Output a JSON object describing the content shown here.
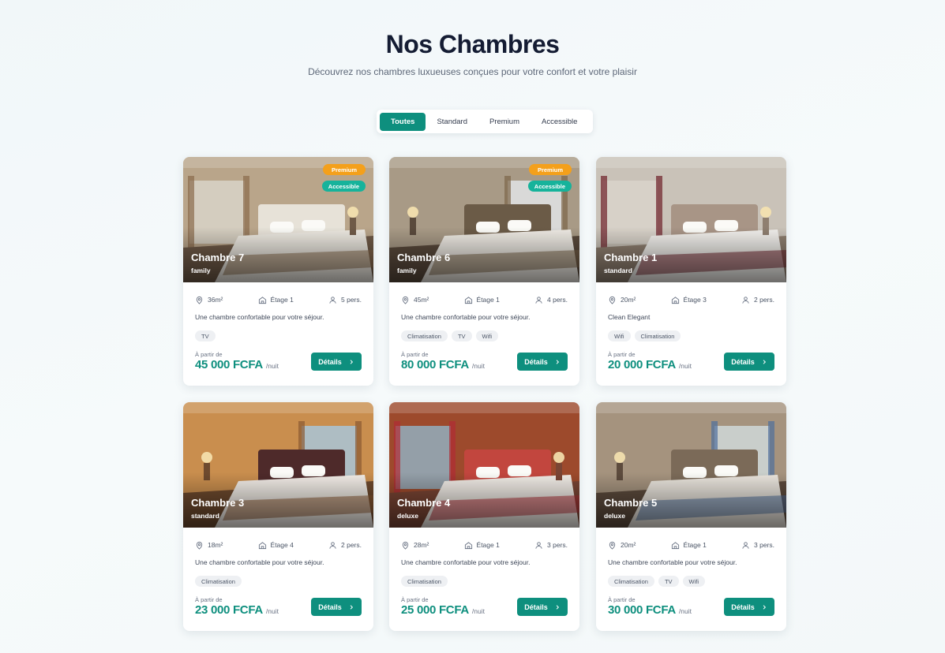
{
  "page": {
    "title": "Nos Chambres",
    "subtitle": "Découvrez nos chambres luxueuses conçues pour votre confort et votre plaisir"
  },
  "filters": [
    {
      "label": "Toutes",
      "active": true
    },
    {
      "label": "Standard",
      "active": false
    },
    {
      "label": "Premium",
      "active": false
    },
    {
      "label": "Accessible",
      "active": false
    }
  ],
  "colors": {
    "accent": "#0e8f7e",
    "premium_badge": "#f4a01b",
    "accessible_badge": "#16b39b"
  },
  "icons": {
    "area": "map-pin-icon",
    "floor": "home-icon",
    "capacity": "user-icon",
    "details": "chevron-right-icon"
  },
  "labels": {
    "price_prefix": "À partir de",
    "price_unit": "/nuit",
    "details_button": "Détails"
  },
  "rooms": [
    {
      "name": "Chambre 7",
      "type": "family",
      "badges": [
        "Premium",
        "Accessible"
      ],
      "area": "36m²",
      "floor": "Étage 1",
      "capacity": "5 pers.",
      "description": "Une chambre confortable pour votre séjour.",
      "amenities": [
        "TV"
      ],
      "price": "45 000 FCFA"
    },
    {
      "name": "Chambre 6",
      "type": "family",
      "badges": [
        "Premium",
        "Accessible"
      ],
      "area": "45m²",
      "floor": "Étage 1",
      "capacity": "4 pers.",
      "description": "Une chambre confortable pour votre séjour.",
      "amenities": [
        "Climatisation",
        "TV",
        "Wifi"
      ],
      "price": "80 000 FCFA"
    },
    {
      "name": "Chambre 1",
      "type": "standard",
      "badges": [],
      "area": "20m²",
      "floor": "Étage 3",
      "capacity": "2 pers.",
      "description": "Clean Elegant",
      "amenities": [
        "Wifi",
        "Climatisation"
      ],
      "price": "20 000 FCFA"
    },
    {
      "name": "Chambre 3",
      "type": "standard",
      "badges": [],
      "area": "18m²",
      "floor": "Étage 4",
      "capacity": "2 pers.",
      "description": "Une chambre confortable pour votre séjour.",
      "amenities": [
        "Climatisation"
      ],
      "price": "23 000 FCFA"
    },
    {
      "name": "Chambre 4",
      "type": "deluxe",
      "badges": [],
      "area": "28m²",
      "floor": "Étage 1",
      "capacity": "3 pers.",
      "description": "Une chambre confortable pour votre séjour.",
      "amenities": [
        "Climatisation"
      ],
      "price": "25 000 FCFA"
    },
    {
      "name": "Chambre 5",
      "type": "deluxe",
      "badges": [],
      "area": "20m²",
      "floor": "Étage 1",
      "capacity": "3 pers.",
      "description": "Une chambre confortable pour votre séjour.",
      "amenities": [
        "Climatisation",
        "TV",
        "Wifi"
      ],
      "price": "30 000 FCFA"
    }
  ]
}
